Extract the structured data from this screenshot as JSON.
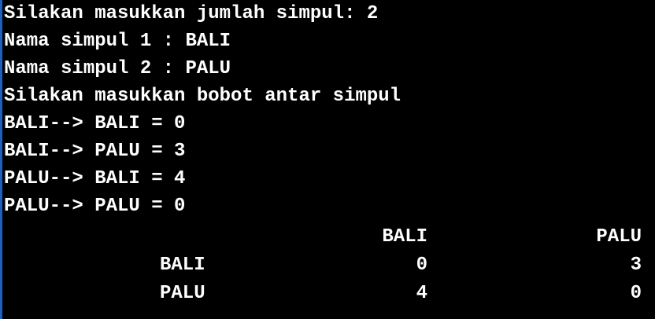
{
  "terminal": {
    "background": "#000000",
    "text_color": "#ffffff",
    "lines": [
      "Silakan masukkan jumlah simpul: 2",
      "Nama simpul 1 : BALI",
      "Nama simpul 2 : PALU",
      "Silakan masukkan bobot antar simpul",
      "BALI--> BALI = 0",
      "BALI--> PALU = 3",
      "PALU--> BALI = 4",
      "PALU--> PALU = 0"
    ],
    "matrix": {
      "col_headers": [
        "BALI",
        "PALU"
      ],
      "rows": [
        {
          "label": "BALI",
          "values": [
            "0",
            "3"
          ]
        },
        {
          "label": "PALU",
          "values": [
            "4",
            "0"
          ]
        }
      ]
    }
  }
}
